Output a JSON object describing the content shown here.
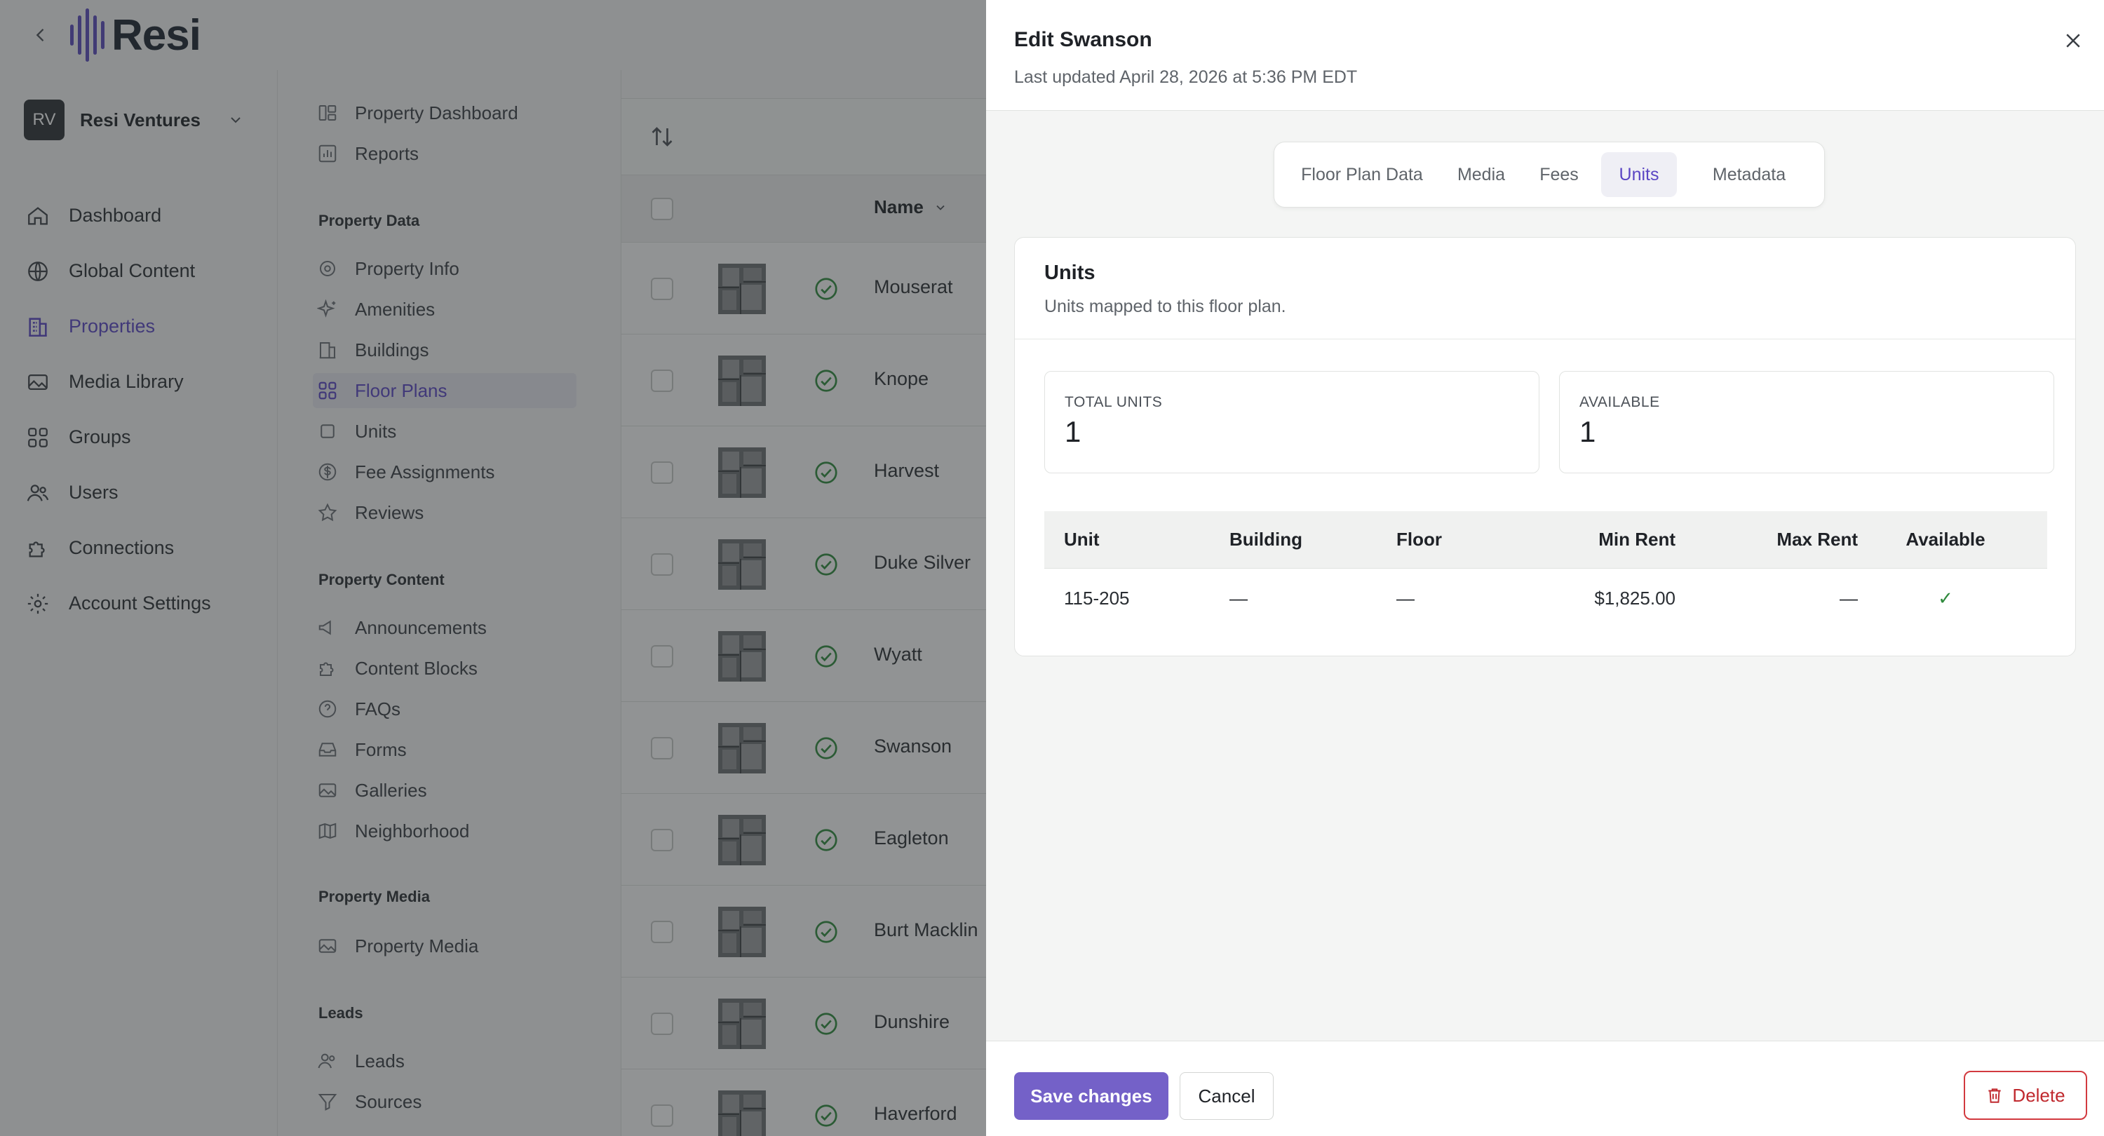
{
  "brand": {
    "name": "Resi"
  },
  "org": {
    "initials": "RV",
    "name": "Resi Ventures"
  },
  "nav": {
    "items": [
      {
        "label": "Dashboard",
        "icon": "home-icon"
      },
      {
        "label": "Global Content",
        "icon": "globe-icon"
      },
      {
        "label": "Properties",
        "icon": "building-icon",
        "active": true
      },
      {
        "label": "Media Library",
        "icon": "image-icon"
      },
      {
        "label": "Groups",
        "icon": "grid-icon"
      },
      {
        "label": "Users",
        "icon": "users-icon"
      },
      {
        "label": "Connections",
        "icon": "puzzle-icon"
      },
      {
        "label": "Account Settings",
        "icon": "gear-icon"
      }
    ]
  },
  "subnav": {
    "top": [
      {
        "label": "Property Dashboard",
        "icon": "dashboard-icon"
      },
      {
        "label": "Reports",
        "icon": "chart-icon"
      }
    ],
    "sections": [
      {
        "heading": "Property Data",
        "items": [
          {
            "label": "Property Info",
            "icon": "gear-icon"
          },
          {
            "label": "Amenities",
            "icon": "sparkle-icon"
          },
          {
            "label": "Buildings",
            "icon": "building-icon"
          },
          {
            "label": "Floor Plans",
            "icon": "grid-icon",
            "active": true
          },
          {
            "label": "Units",
            "icon": "square-icon"
          },
          {
            "label": "Fee Assignments",
            "icon": "dollar-icon"
          },
          {
            "label": "Reviews",
            "icon": "star-icon"
          }
        ]
      },
      {
        "heading": "Property Content",
        "items": [
          {
            "label": "Announcements",
            "icon": "megaphone-icon"
          },
          {
            "label": "Content Blocks",
            "icon": "puzzle-icon"
          },
          {
            "label": "FAQs",
            "icon": "question-icon"
          },
          {
            "label": "Forms",
            "icon": "inbox-icon"
          },
          {
            "label": "Galleries",
            "icon": "image-icon"
          },
          {
            "label": "Neighborhood",
            "icon": "map-icon"
          }
        ]
      },
      {
        "heading": "Property Media",
        "items": [
          {
            "label": "Property Media",
            "icon": "image-icon"
          }
        ]
      },
      {
        "heading": "Leads",
        "items": [
          {
            "label": "Leads",
            "icon": "users-icon"
          },
          {
            "label": "Sources",
            "icon": "filter-icon"
          }
        ]
      }
    ]
  },
  "list": {
    "column_name": "Name",
    "rows": [
      "Mouserat",
      "Knope",
      "Harvest",
      "Duke Silver",
      "Wyatt",
      "Swanson",
      "Eagleton",
      "Burt Macklin",
      "Dunshire",
      "Haverford"
    ]
  },
  "drawer": {
    "title": "Edit Swanson",
    "subtitle": "Last updated April 28, 2026 at 5:36 PM EDT",
    "tabs": [
      {
        "label": "Floor Plan Data"
      },
      {
        "label": "Media"
      },
      {
        "label": "Fees"
      },
      {
        "label": "Units",
        "active": true
      },
      {
        "label": "Metadata"
      }
    ],
    "card": {
      "title": "Units",
      "description": "Units mapped to this floor plan.",
      "stats": [
        {
          "label": "TOTAL UNITS",
          "value": "1"
        },
        {
          "label": "AVAILABLE",
          "value": "1"
        }
      ],
      "table": {
        "headers": [
          "Unit",
          "Building",
          "Floor",
          "Min Rent",
          "Max Rent",
          "Available"
        ],
        "rows": [
          [
            "115-205",
            "—",
            "—",
            "$1,825.00",
            "—",
            "✓"
          ]
        ]
      }
    },
    "footer": {
      "save_label": "Save changes",
      "cancel_label": "Cancel",
      "delete_label": "Delete"
    }
  },
  "colors": {
    "accent": "#5b46c4",
    "primary_button": "#7461c8",
    "danger": "#d23a3f",
    "success": "#2f8a3d"
  }
}
